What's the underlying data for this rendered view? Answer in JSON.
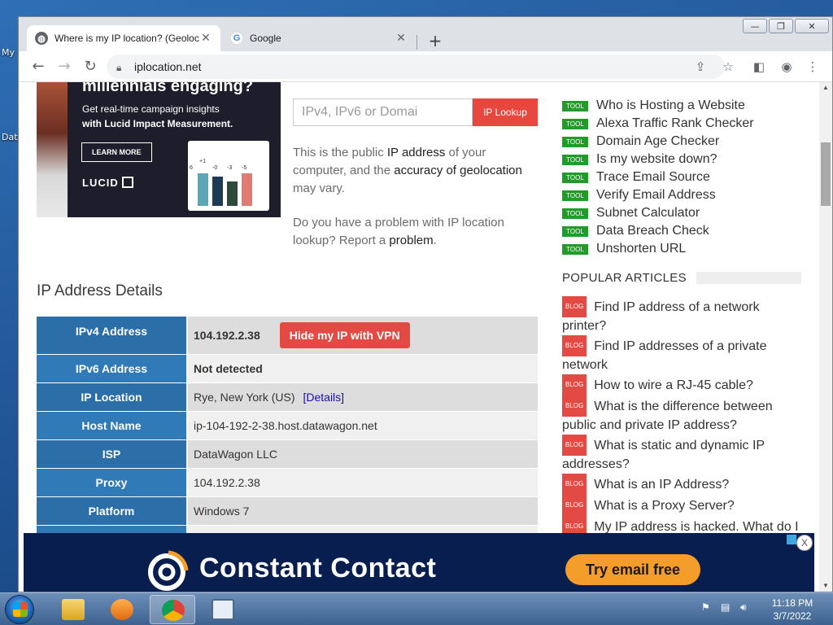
{
  "desktop": {
    "icons": [
      "My",
      "Dat"
    ]
  },
  "tabs": [
    {
      "title": "Where is my IP location? (Geoloc",
      "favicon": "globe-icon"
    },
    {
      "title": "Google",
      "favicon": "google-icon"
    }
  ],
  "toolbar": {
    "url": "iplocation.net"
  },
  "ad_top": {
    "headline": "millennials engaging?",
    "subtext_1": "Get real-time campaign insights",
    "subtext_2": "with Lucid Impact Measurement.",
    "cta": "LEARN MORE",
    "brand": "LUCID",
    "mini_labels": [
      "6",
      "+1",
      "-0",
      "-3",
      "-5"
    ]
  },
  "lookup": {
    "placeholder": "IPv4, IPv6 or Domai",
    "button": "IP Lookup"
  },
  "intro": {
    "p1_a": "This is the public ",
    "p1_link1": "IP address",
    "p1_b": " of your computer, and the ",
    "p1_link2": "accuracy of geolocation",
    "p1_c": " may vary.",
    "p2_a": "Do you have a problem with IP location lookup? Report a ",
    "p2_link": "problem",
    "p2_b": "."
  },
  "details": {
    "title": "IP Address Details",
    "vpn_button": "Hide my IP with VPN",
    "details_link": "[Details]",
    "rows": [
      {
        "label": "IPv4 Address",
        "value": "104.192.2.38"
      },
      {
        "label": "IPv6 Address",
        "value": "Not detected"
      },
      {
        "label": "IP Location",
        "value": "Rye, New York (US)"
      },
      {
        "label": "Host Name",
        "value": "ip-104-192-2-38.host.datawagon.net"
      },
      {
        "label": "ISP",
        "value": "DataWagon LLC"
      },
      {
        "label": "Proxy",
        "value": "104.192.2.38"
      },
      {
        "label": "Platform",
        "value": "Windows 7"
      }
    ]
  },
  "tools": {
    "badge": "TOOL",
    "items": [
      "Who is Hosting a Website",
      "Alexa Traffic Rank Checker",
      "Domain Age Checker",
      "Is my website down?",
      "Trace Email Source",
      "Verify Email Address",
      "Subnet Calculator",
      "Data Breach Check",
      "Unshorten URL"
    ]
  },
  "articles": {
    "heading": "POPULAR ARTICLES",
    "badge": "BLOG",
    "items": [
      "Find IP address of a network printer?",
      "Find IP addresses of a private network",
      "How to wire a RJ-45 cable?",
      "What is the difference between public and private IP address?",
      "What is static and dynamic IP addresses?",
      "What is an IP Address?",
      "What is a Proxy Server?",
      "My IP address is hacked. What do I"
    ]
  },
  "ad_bottom": {
    "brand": "Constant Contact",
    "cta": "Try email free",
    "close": "X"
  },
  "clock": {
    "time": "11:18 PM",
    "date": "3/7/2022"
  },
  "colors": {
    "table_label": "#2b6ea8",
    "tool_badge": "#1f9d28",
    "blog_badge": "#e24a43",
    "lookup_button": "#e8473f",
    "ad_bottom_bg": "#081e4f",
    "cc_button": "#f49d2b"
  }
}
